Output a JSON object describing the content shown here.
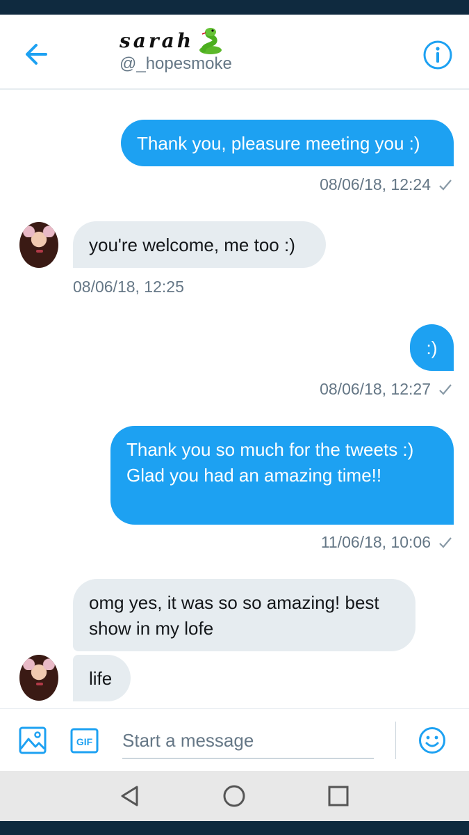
{
  "header": {
    "contact_name": "sarah",
    "snake_emoji": "snake-emoji",
    "handle": "@_hopesmoke",
    "back_icon": "arrow-left-icon",
    "info_icon": "info-icon"
  },
  "colors": {
    "accent": "#1da1f2",
    "incoming_bubble": "#e6ecf0",
    "timestamp": "#657786",
    "status_bar": "#0f2a3f"
  },
  "messages": [
    {
      "direction": "outgoing",
      "text": "Thank you, pleasure meeting you :)",
      "timestamp": "08/06/18, 12:24",
      "status": "check-icon"
    },
    {
      "direction": "incoming",
      "text": "you're welcome, me too :)",
      "timestamp": "08/06/18, 12:25"
    },
    {
      "direction": "outgoing",
      "text": ":)",
      "timestamp": "08/06/18, 12:27",
      "status": "check-icon"
    },
    {
      "direction": "outgoing",
      "text": "Thank you so much for the tweets :) Glad you had an amazing time!!",
      "timestamp": "11/06/18, 10:06",
      "status": "check-icon"
    },
    {
      "direction": "incoming",
      "text": "omg yes, it was so so amazing! best show in my lofe"
    },
    {
      "direction": "incoming",
      "text": "life"
    }
  ],
  "composer": {
    "placeholder": "Start a message",
    "media_icon": "image-icon",
    "gif_label": "GIF",
    "emoji_icon": "emoji-icon"
  },
  "nav": {
    "back_icon": "triangle-back-icon",
    "home_icon": "circle-home-icon",
    "recents_icon": "square-recents-icon"
  }
}
